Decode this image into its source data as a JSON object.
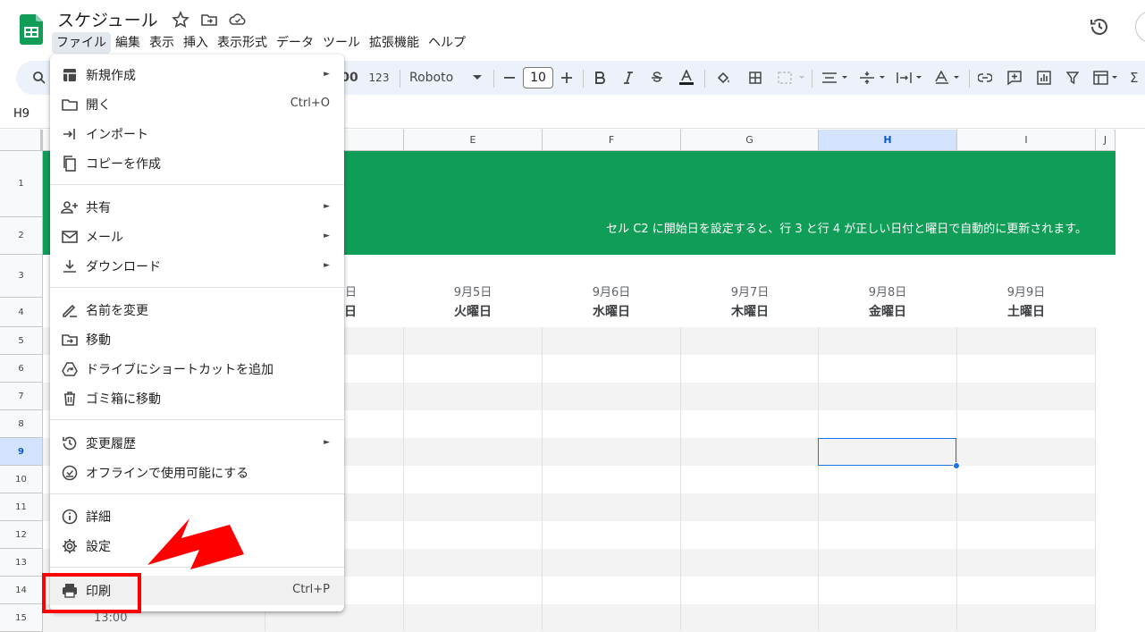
{
  "doc": {
    "title": "スケジュール"
  },
  "menubar": [
    "ファイル",
    "編集",
    "表示",
    "挿入",
    "表示形式",
    "データ",
    "ツール",
    "拡張機能",
    "ヘルプ"
  ],
  "toolbar": {
    "format_number": "123",
    "font": "Roboto",
    "font_size": "10"
  },
  "namebox": "H9",
  "columns": [
    "E",
    "F",
    "G",
    "H",
    "I",
    "J"
  ],
  "rows": [
    "1",
    "2",
    "3",
    "4",
    "5",
    "6",
    "7",
    "8",
    "9",
    "10",
    "11",
    "12",
    "13",
    "14",
    "15"
  ],
  "banner": {
    "text": "セル C2 に開始日を設定すると、行 3 と行 4 が正しい日付と曜日で自動的に更新されます。"
  },
  "schedule": {
    "partial_date": "日",
    "partial_day": "日",
    "dates": [
      "9月5日",
      "9月6日",
      "9月7日",
      "9月8日",
      "9月9日"
    ],
    "days": [
      "火曜日",
      "水曜日",
      "木曜日",
      "金曜日",
      "土曜日"
    ],
    "time": "13:00"
  },
  "file_menu": {
    "new": "新規作成",
    "open": "開く",
    "open_shortcut": "Ctrl+O",
    "import": "インポート",
    "copy": "コピーを作成",
    "share": "共有",
    "email": "メール",
    "download": "ダウンロード",
    "rename": "名前を変更",
    "move": "移動",
    "shortcut": "ドライブにショートカットを追加",
    "trash": "ゴミ箱に移動",
    "history": "変更履歴",
    "offline": "オフラインで使用可能にする",
    "details": "詳細",
    "settings": "設定",
    "print": "印刷",
    "print_shortcut": "Ctrl+P",
    "submenu_arrow": "►"
  },
  "colors": {
    "banner": "#109d58",
    "highlight": "#ff0000",
    "selection": "#1a73e8"
  }
}
